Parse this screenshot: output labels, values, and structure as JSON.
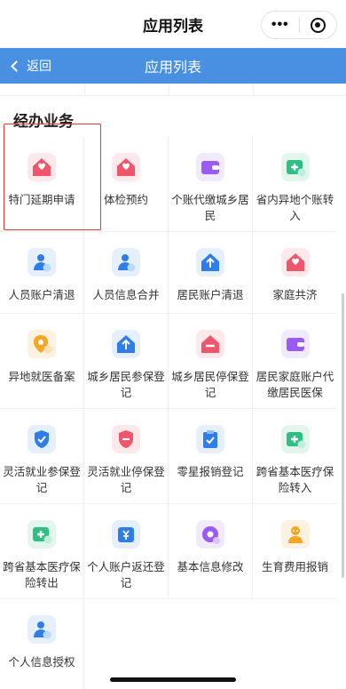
{
  "header": {
    "title": "应用列表",
    "more_glyph": "•••"
  },
  "nav": {
    "back_label": "返回",
    "title": "应用列表"
  },
  "section": {
    "title": "经办业务"
  },
  "colors": {
    "nav_blue": "#4a90e2",
    "highlight_red": "#e53935"
  },
  "apps": [
    {
      "label": "特门延期申请",
      "icon": "house-heart-icon"
    },
    {
      "label": "体检预约",
      "icon": "house-heart-icon"
    },
    {
      "label": "个账代缴城乡居民",
      "icon": "wallet-icon"
    },
    {
      "label": "省内异地个账转入",
      "icon": "medical-transfer-icon"
    },
    {
      "label": "人员账户清退",
      "icon": "person-check-icon"
    },
    {
      "label": "人员信息合并",
      "icon": "person-check-icon"
    },
    {
      "label": "居民账户清退",
      "icon": "house-arrow-icon"
    },
    {
      "label": "家庭共济",
      "icon": "house-heart-icon"
    },
    {
      "label": "异地就医备案",
      "icon": "location-plus-icon"
    },
    {
      "label": "城乡居民参保登记",
      "icon": "house-arrow-icon"
    },
    {
      "label": "城乡居民停保登记",
      "icon": "house-minus-icon"
    },
    {
      "label": "居民家庭账户代缴居民医保",
      "icon": "wallet-icon"
    },
    {
      "label": "灵活就业参保登记",
      "icon": "shield-check-icon"
    },
    {
      "label": "灵活就业停保登记",
      "icon": "shield-minus-icon"
    },
    {
      "label": "零星报销登记",
      "icon": "clipboard-check-icon"
    },
    {
      "label": "跨省基本医疗保险转入",
      "icon": "medical-transfer-icon"
    },
    {
      "label": "跨省基本医疗保险转出",
      "icon": "medical-transfer-icon"
    },
    {
      "label": "个人账户返还登记",
      "icon": "yen-card-icon"
    },
    {
      "label": "基本信息修改",
      "icon": "gear-icon"
    },
    {
      "label": "生育费用报销",
      "icon": "baby-icon"
    },
    {
      "label": "个人信息授权",
      "icon": "person-check-icon"
    }
  ]
}
